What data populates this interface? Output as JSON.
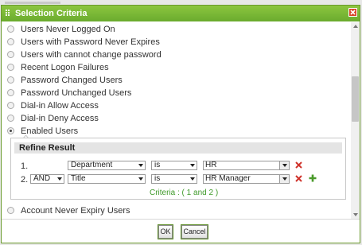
{
  "dialog": {
    "title": "Selection Criteria"
  },
  "options": [
    {
      "label": "Users Never Logged On",
      "selected": false
    },
    {
      "label": "Users with Password Never Expires",
      "selected": false
    },
    {
      "label": "Users with cannot change password",
      "selected": false
    },
    {
      "label": "Recent Logon Failures",
      "selected": false
    },
    {
      "label": "Password Changed Users",
      "selected": false
    },
    {
      "label": "Password Unchanged Users",
      "selected": false
    },
    {
      "label": "Dial-in Allow Access",
      "selected": false
    },
    {
      "label": "Dial-in Deny Access",
      "selected": false
    },
    {
      "label": "Enabled Users",
      "selected": true
    },
    {
      "label": "Account Never Expiry Users",
      "selected": false
    }
  ],
  "refine": {
    "header": "Refine Result",
    "rows": [
      {
        "number": "1.",
        "field": "Department",
        "operator": "is",
        "value": "HR"
      },
      {
        "number": "2.",
        "connector": "AND",
        "field": "Title",
        "operator": "is",
        "value": "HR Manager"
      }
    ],
    "summary": "Criteria : ( 1 and 2 )"
  },
  "footer": {
    "ok_label": "OK",
    "cancel_label": "Cancel"
  },
  "colors": {
    "title_bar": "#78b536",
    "summary_text": "#3f9a2a",
    "remove_icon": "#d0342c",
    "add_icon": "#4a9a2a"
  },
  "icons": {
    "title_grip": "grip-icon",
    "close": "close-icon",
    "remove_row": "remove-row-icon",
    "add_row": "add-row-icon"
  }
}
